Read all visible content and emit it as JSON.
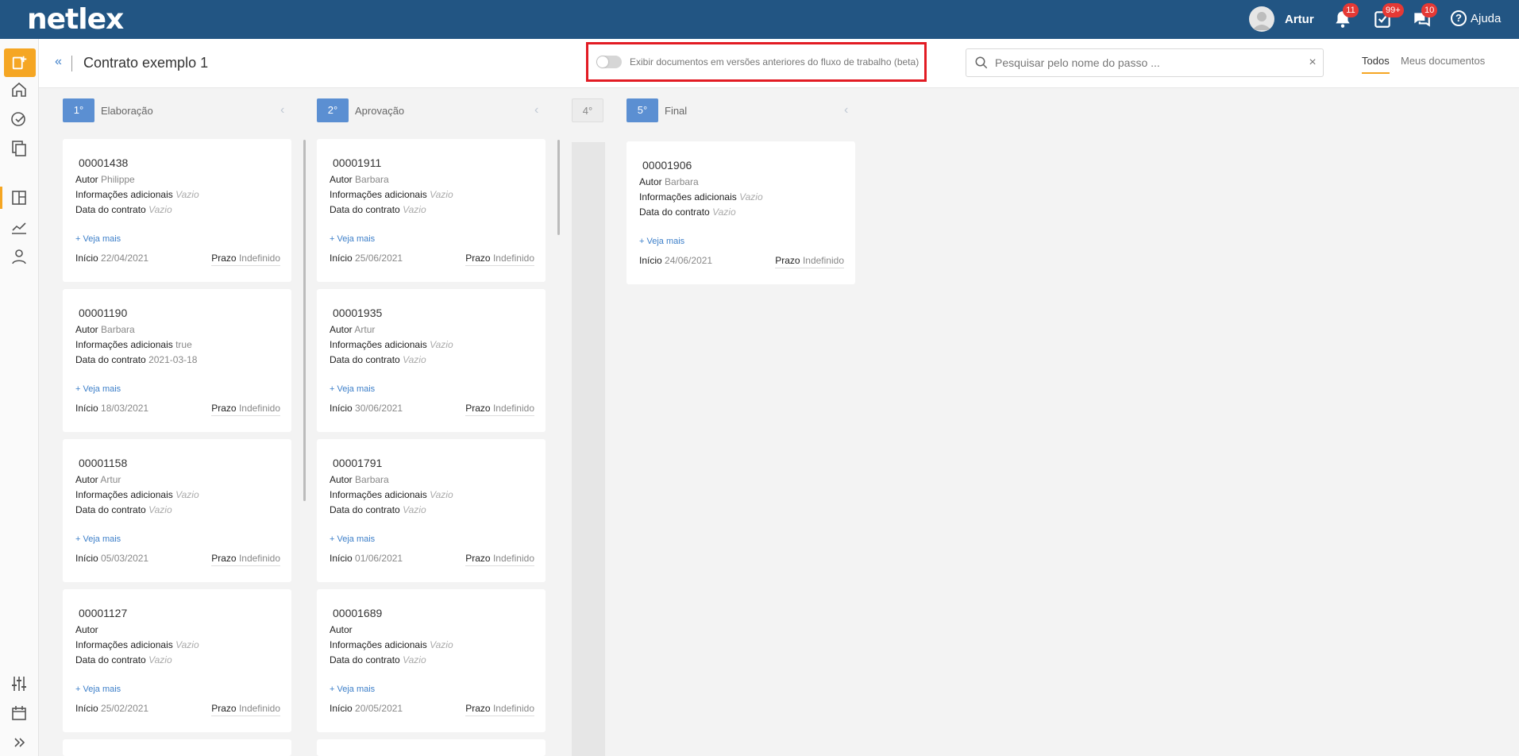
{
  "app": {
    "logo": "netlex"
  },
  "topbar": {
    "user_name": "Artur",
    "notifications_badge": "11",
    "tasks_badge": "99+",
    "messages_badge": "10",
    "help_label": "Ajuda"
  },
  "header": {
    "collapse_icon": "«",
    "title": "Contrato exemplo 1",
    "toggle_label": "Exibir documentos em versões anteriores do fluxo de trabalho (beta)",
    "search_placeholder": "Pesquisar pelo nome do passo ...",
    "clear_icon": "×",
    "tabs": [
      {
        "label": "Todos",
        "active": true
      },
      {
        "label": "Meus documentos",
        "active": false
      }
    ]
  },
  "labels": {
    "author": "Autor",
    "additional_info": "Informações adicionais",
    "contract_date": "Data do contrato",
    "see_more": "+ Veja mais",
    "start": "Início",
    "deadline": "Prazo"
  },
  "columns": [
    {
      "step": "1°",
      "name": "Elaboração",
      "cards": [
        {
          "id": "00001438",
          "author": "Philippe",
          "info": "Vazio",
          "date": "Vazio",
          "start": "22/04/2021",
          "deadline": "Indefinido"
        },
        {
          "id": "00001190",
          "author": "Barbara",
          "info": "true",
          "date": "2021-03-18",
          "start": "18/03/2021",
          "deadline": "Indefinido"
        },
        {
          "id": "00001158",
          "author": "Artur",
          "info": "Vazio",
          "date": "Vazio",
          "start": "05/03/2021",
          "deadline": "Indefinido"
        },
        {
          "id": "00001127",
          "author": "",
          "info": "Vazio",
          "date": "Vazio",
          "start": "25/02/2021",
          "deadline": "Indefinido"
        }
      ]
    },
    {
      "step": "2°",
      "name": "Aprovação",
      "cards": [
        {
          "id": "00001911",
          "author": "Barbara",
          "info": "Vazio",
          "date": "Vazio",
          "start": "25/06/2021",
          "deadline": "Indefinido"
        },
        {
          "id": "00001935",
          "author": "Artur",
          "info": "Vazio",
          "date": "Vazio",
          "start": "30/06/2021",
          "deadline": "Indefinido"
        },
        {
          "id": "00001791",
          "author": "Barbara",
          "info": "Vazio",
          "date": "Vazio",
          "start": "01/06/2021",
          "deadline": "Indefinido"
        },
        {
          "id": "00001689",
          "author": "",
          "info": "Vazio",
          "date": "Vazio",
          "start": "20/05/2021",
          "deadline": "Indefinido"
        }
      ]
    },
    {
      "step": "4°",
      "name": "",
      "cards": []
    },
    {
      "step": "5°",
      "name": "Final",
      "cards": [
        {
          "id": "00001906",
          "author": "Barbara",
          "info": "Vazio",
          "date": "Vazio",
          "start": "24/06/2021",
          "deadline": "Indefinido"
        }
      ]
    }
  ],
  "icons": {
    "sidebar": [
      "new-document-icon",
      "home-icon",
      "check-circle-icon",
      "documents-icon",
      "workflow-board-icon",
      "chart-icon",
      "user-icon",
      "settings-sliders-icon",
      "calendar-icon",
      "expand-icon"
    ],
    "top": [
      "avatar",
      "bell-icon",
      "tasks-icon",
      "messages-icon",
      "help-icon"
    ]
  },
  "colors": {
    "topbar": "#225583",
    "accent": "#f5a623",
    "step": "#5b8fd2",
    "highlight": "#e21b23",
    "badge": "#e53935"
  }
}
